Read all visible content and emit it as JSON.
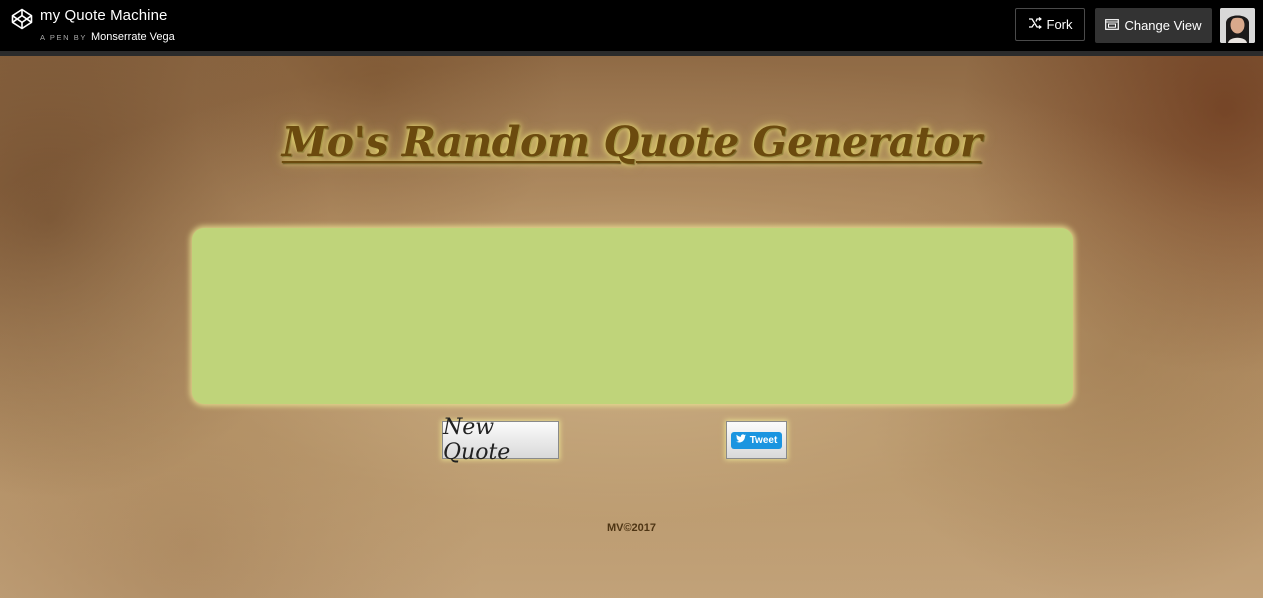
{
  "codepen_header": {
    "pen_title": "my Quote Machine",
    "byline_prefix": "A PEN BY",
    "author": "Monserrate Vega",
    "fork_label": "Fork",
    "change_view_label": "Change View",
    "icons": {
      "logo": "codepen-logo-icon",
      "fork": "fork-icon",
      "change_view": "change-view-icon"
    }
  },
  "app": {
    "title": "Mo's Random Quote Generator",
    "quote_text": "",
    "new_quote_label": "New Quote",
    "tweet_label": "Tweet",
    "footer": "MV©2017"
  },
  "colors": {
    "heading": "#6b4a0e",
    "quote_box": "#bfd47a",
    "tweet_button": "#1b95e0",
    "topbar": "#000000"
  }
}
